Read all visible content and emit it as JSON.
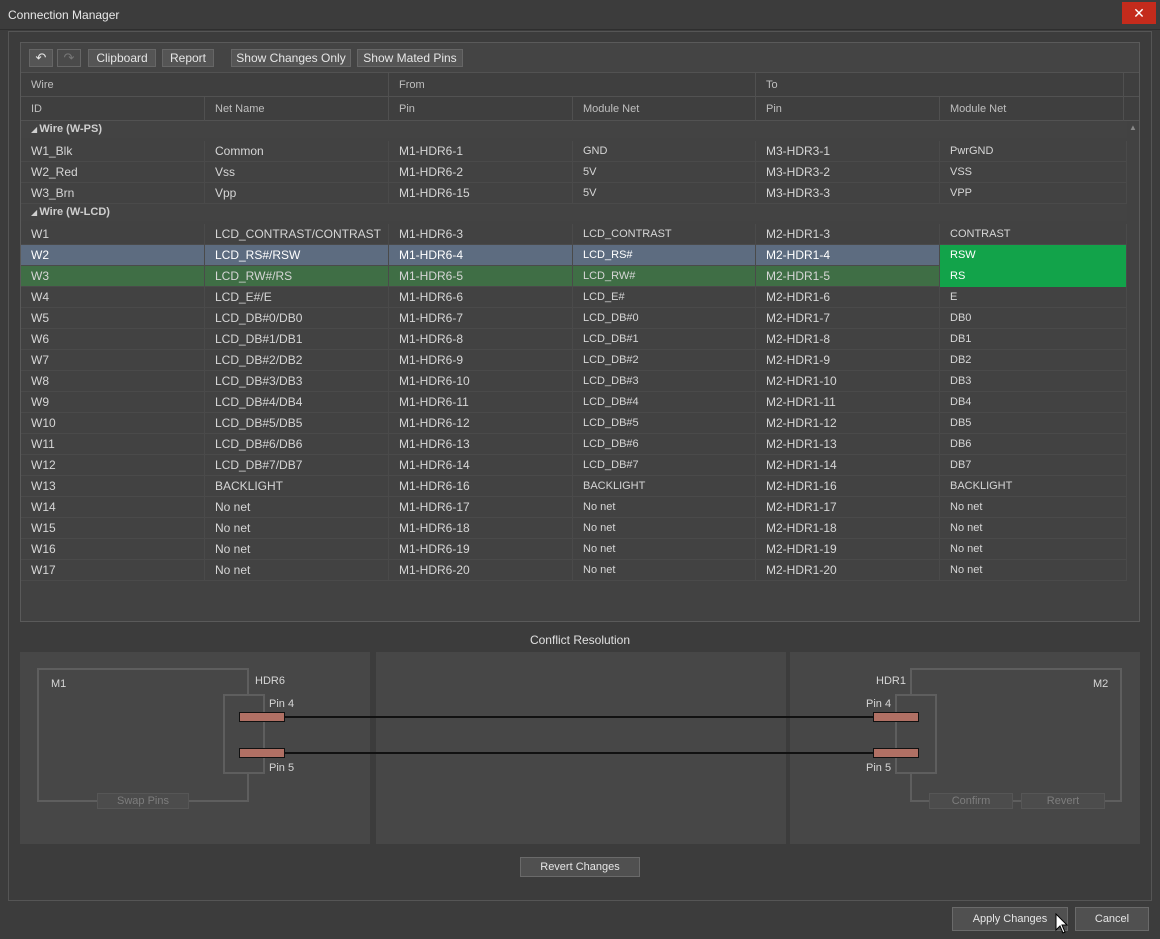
{
  "window": {
    "title": "Connection Manager",
    "close_glyph": "✕"
  },
  "toolbar": {
    "undo_icon": "↶",
    "redo_icon": "↷",
    "clipboard": "Clipboard",
    "report": "Report",
    "show_changes_only": "Show Changes Only",
    "show_mated_pins": "Show Mated Pins"
  },
  "columns": {
    "group_wire": "Wire",
    "group_from": "From",
    "group_to": "To",
    "id": "ID",
    "net_name": "Net Name",
    "from_pin": "Pin",
    "from_module_net": "Module Net",
    "to_pin": "Pin",
    "to_module_net": "Module Net"
  },
  "groups": [
    {
      "label": "Wire (W-PS)",
      "rows": [
        {
          "id": "W1_Blk",
          "net": "Common",
          "from_pin": "M1-HDR6-1",
          "from_net": "GND",
          "to_pin": "M3-HDR3-1",
          "to_net": "PwrGND"
        },
        {
          "id": "W2_Red",
          "net": "Vss",
          "from_pin": "M1-HDR6-2",
          "from_net": "5V",
          "to_pin": "M3-HDR3-2",
          "to_net": "VSS"
        },
        {
          "id": "W3_Brn",
          "net": "Vpp",
          "from_pin": "M1-HDR6-15",
          "from_net": "5V",
          "to_pin": "M3-HDR3-3",
          "to_net": "VPP"
        }
      ]
    },
    {
      "label": "Wire (W-LCD)",
      "rows": [
        {
          "id": "W1",
          "net": "LCD_CONTRAST/CONTRAST",
          "from_pin": "M1-HDR6-3",
          "from_net": "LCD_CONTRAST",
          "to_pin": "M2-HDR1-3",
          "to_net": "CONTRAST"
        },
        {
          "id": "W2",
          "net": "LCD_RS#/RSW",
          "from_pin": "M1-HDR6-4",
          "from_net": "LCD_RS#",
          "to_pin": "M2-HDR1-4",
          "to_net": "RSW"
        },
        {
          "id": "W3",
          "net": "LCD_RW#/RS",
          "from_pin": "M1-HDR6-5",
          "from_net": "LCD_RW#",
          "to_pin": "M2-HDR1-5",
          "to_net": "RS"
        },
        {
          "id": "W4",
          "net": "LCD_E#/E",
          "from_pin": "M1-HDR6-6",
          "from_net": "LCD_E#",
          "to_pin": "M2-HDR1-6",
          "to_net": "E"
        },
        {
          "id": "W5",
          "net": "LCD_DB#0/DB0",
          "from_pin": "M1-HDR6-7",
          "from_net": "LCD_DB#0",
          "to_pin": "M2-HDR1-7",
          "to_net": "DB0"
        },
        {
          "id": "W6",
          "net": "LCD_DB#1/DB1",
          "from_pin": "M1-HDR6-8",
          "from_net": "LCD_DB#1",
          "to_pin": "M2-HDR1-8",
          "to_net": "DB1"
        },
        {
          "id": "W7",
          "net": "LCD_DB#2/DB2",
          "from_pin": "M1-HDR6-9",
          "from_net": "LCD_DB#2",
          "to_pin": "M2-HDR1-9",
          "to_net": "DB2"
        },
        {
          "id": "W8",
          "net": "LCD_DB#3/DB3",
          "from_pin": "M1-HDR6-10",
          "from_net": "LCD_DB#3",
          "to_pin": "M2-HDR1-10",
          "to_net": "DB3"
        },
        {
          "id": "W9",
          "net": "LCD_DB#4/DB4",
          "from_pin": "M1-HDR6-11",
          "from_net": "LCD_DB#4",
          "to_pin": "M2-HDR1-11",
          "to_net": "DB4"
        },
        {
          "id": "W10",
          "net": "LCD_DB#5/DB5",
          "from_pin": "M1-HDR6-12",
          "from_net": "LCD_DB#5",
          "to_pin": "M2-HDR1-12",
          "to_net": "DB5"
        },
        {
          "id": "W11",
          "net": "LCD_DB#6/DB6",
          "from_pin": "M1-HDR6-13",
          "from_net": "LCD_DB#6",
          "to_pin": "M2-HDR1-13",
          "to_net": "DB6"
        },
        {
          "id": "W12",
          "net": "LCD_DB#7/DB7",
          "from_pin": "M1-HDR6-14",
          "from_net": "LCD_DB#7",
          "to_pin": "M2-HDR1-14",
          "to_net": "DB7"
        },
        {
          "id": "W13",
          "net": "BACKLIGHT",
          "from_pin": "M1-HDR6-16",
          "from_net": "BACKLIGHT",
          "to_pin": "M2-HDR1-16",
          "to_net": "BACKLIGHT"
        },
        {
          "id": "W14",
          "net": "No net",
          "from_pin": "M1-HDR6-17",
          "from_net": "No net",
          "to_pin": "M2-HDR1-17",
          "to_net": "No net"
        },
        {
          "id": "W15",
          "net": "No net",
          "from_pin": "M1-HDR6-18",
          "from_net": "No net",
          "to_pin": "M2-HDR1-18",
          "to_net": "No net"
        },
        {
          "id": "W16",
          "net": "No net",
          "from_pin": "M1-HDR6-19",
          "from_net": "No net",
          "to_pin": "M2-HDR1-19",
          "to_net": "No net"
        },
        {
          "id": "W17",
          "net": "No net",
          "from_pin": "M1-HDR6-20",
          "from_net": "No net",
          "to_pin": "M2-HDR1-20",
          "to_net": "No net"
        }
      ]
    }
  ],
  "selected_row": "W2",
  "changed_row": "W3",
  "colors": {
    "selected": "#5d6c80",
    "changed": "#3f6e45",
    "highlight": "#12a34a",
    "pin": "#b07064"
  },
  "conflict": {
    "title": "Conflict Resolution",
    "left_module": "M1",
    "left_header": "HDR6",
    "right_module": "M2",
    "right_header": "HDR1",
    "pin_a": "Pin 4",
    "pin_b": "Pin 5",
    "swap_pins": "Swap Pins",
    "confirm": "Confirm",
    "revert": "Revert"
  },
  "footer": {
    "revert_changes": "Revert Changes",
    "apply_changes": "Apply Changes",
    "cancel": "Cancel"
  }
}
